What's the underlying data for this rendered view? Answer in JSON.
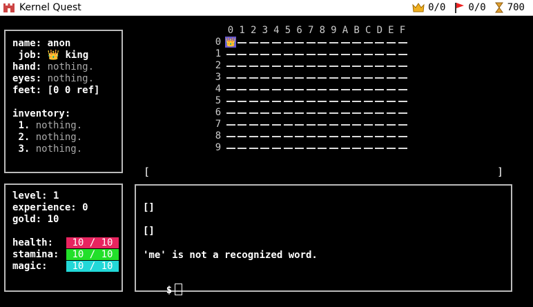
{
  "window": {
    "title": "Kernel Quest",
    "stats": {
      "crowns": "0/0",
      "flags": "0/0",
      "time": "700"
    }
  },
  "character": {
    "name_label": "name:",
    "name": "anon",
    "job_label": "job:",
    "job_icon": "👑",
    "job": "king",
    "hand_label": "hand:",
    "hand": "nothing.",
    "eyes_label": "eyes:",
    "eyes": "nothing.",
    "feet_label": "feet:",
    "feet": "[0 0 ref]",
    "inventory_label": "inventory:",
    "inventory": [
      {
        "index": "1.",
        "item": "nothing."
      },
      {
        "index": "2.",
        "item": "nothing."
      },
      {
        "index": "3.",
        "item": "nothing."
      }
    ]
  },
  "stats_panel": {
    "level_label": "level:",
    "level": "1",
    "experience_label": "experience:",
    "experience": "0",
    "gold_label": "gold:",
    "gold": "10",
    "health_label": "health:",
    "health": "10 / 10",
    "health_fraction": 1.0,
    "health_color": "#e8245f",
    "stamina_label": "stamina:",
    "stamina": "10 / 10",
    "stamina_fraction": 1.0,
    "stamina_color": "#22e02a",
    "magic_label": "magic:",
    "magic": "10 / 10",
    "magic_fraction": 1.0,
    "magic_color": "#22d8d8"
  },
  "map": {
    "columns": [
      "0",
      "1",
      "2",
      "3",
      "4",
      "5",
      "6",
      "7",
      "8",
      "9",
      "A",
      "B",
      "C",
      "D",
      "E",
      "F"
    ],
    "rows": [
      "0",
      "1",
      "2",
      "3",
      "4",
      "5",
      "6",
      "7",
      "8",
      "9"
    ],
    "player_icon": "👑",
    "player_cell": {
      "row": 0,
      "col": 0
    }
  },
  "message_bar": {
    "left": "[",
    "right": "]"
  },
  "console": {
    "lines": [
      "[]",
      "[]",
      "'me' is not a recognized word."
    ],
    "prompt": "$"
  }
}
